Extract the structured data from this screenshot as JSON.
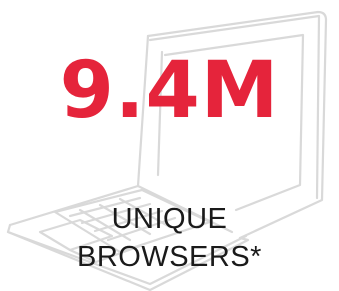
{
  "stat": {
    "value": "9.4M",
    "label_line1": "UNIQUE",
    "label_line2": "BROWSERS*"
  },
  "illustration": {
    "icon": "laptop-icon"
  },
  "colors": {
    "accent": "#e5243b",
    "text": "#1a1a1a",
    "sketch": "#d9d9d9"
  }
}
